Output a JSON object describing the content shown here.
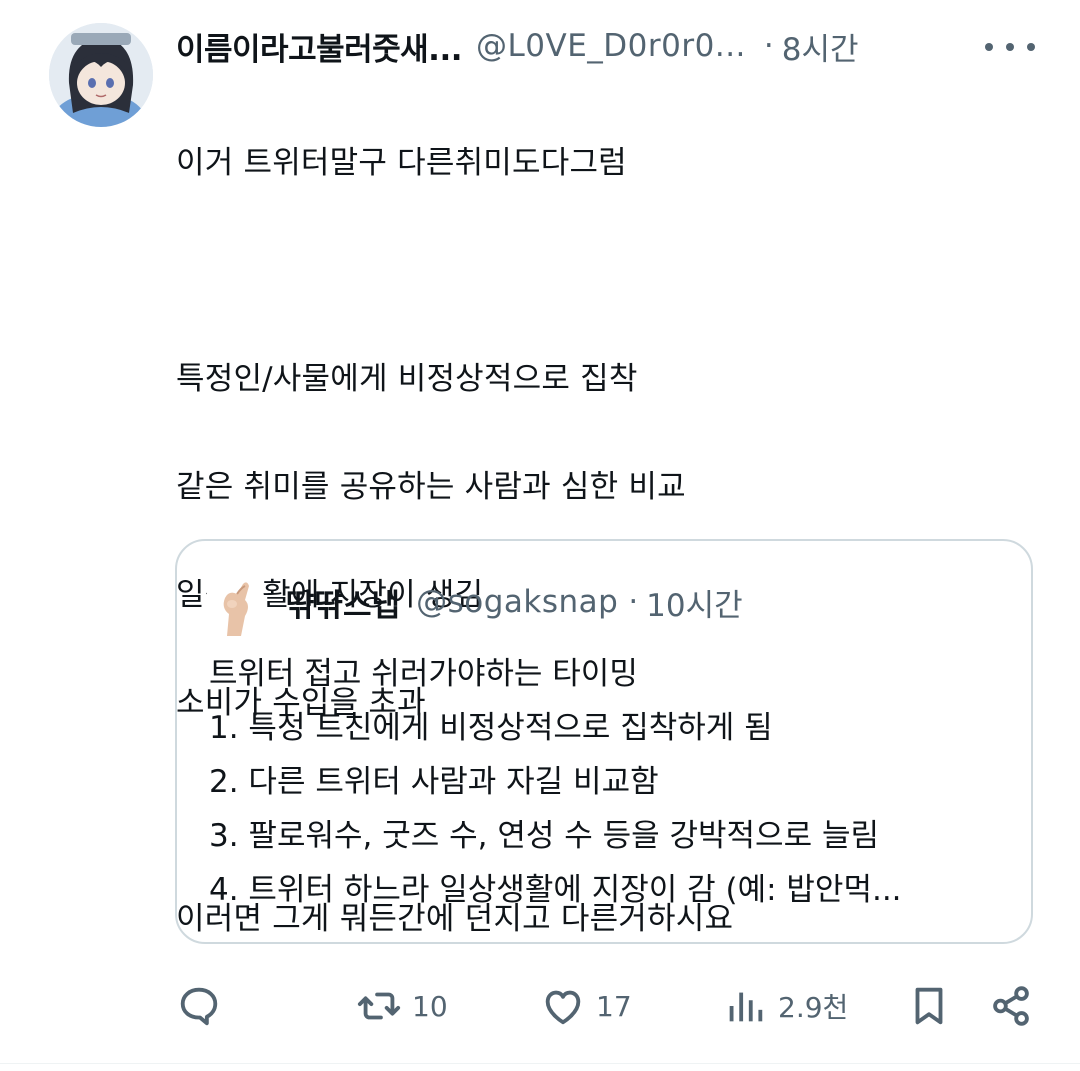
{
  "tweet": {
    "display_name": "이름이라고불러줏새...",
    "handle": "@L0VE_D0r0r0...",
    "separator": "·",
    "time": "8시간",
    "lines": [
      "이거 트위터말구 다른취미도다그럼",
      "",
      "특정인/사물에게 비정상적으로 집착",
      "같은 취미를 공유하는 사람과 심한 비교",
      "일상생활에 지장이 생김",
      "소비가 수입을 초과",
      "",
      "이러면 그게 뭐든간에 던지고 다른거하시요"
    ]
  },
  "quote": {
    "display_name": "땪땪스냅",
    "handle": "@sogaksnap",
    "separator": "·",
    "time": "10시간",
    "lines": [
      "트위터 접고 쉬러가야하는 타이밍",
      "1. 특정 트친에게 비정상적으로 집착하게 됨",
      "2. 다른 트위터 사람과 자길 비교함",
      "3. 팔로워수, 굿즈 수, 연성 수 등을 강박적으로 늘림",
      "4. 트위터 하느라 일상생활에 지장이 감 (예: 밥안먹..."
    ]
  },
  "actions": {
    "reply_count": "",
    "retweet_count": "10",
    "like_count": "17",
    "views_count": "2.9천"
  },
  "colors": {
    "text": "#0f1419",
    "secondary": "#536471",
    "border": "#cfd9de"
  },
  "icons": {
    "more": "more-horizontal-icon",
    "reply": "reply-icon",
    "retweet": "retweet-icon",
    "like": "heart-icon",
    "views": "views-chart-icon",
    "bookmark": "bookmark-icon",
    "share": "share-icon"
  }
}
